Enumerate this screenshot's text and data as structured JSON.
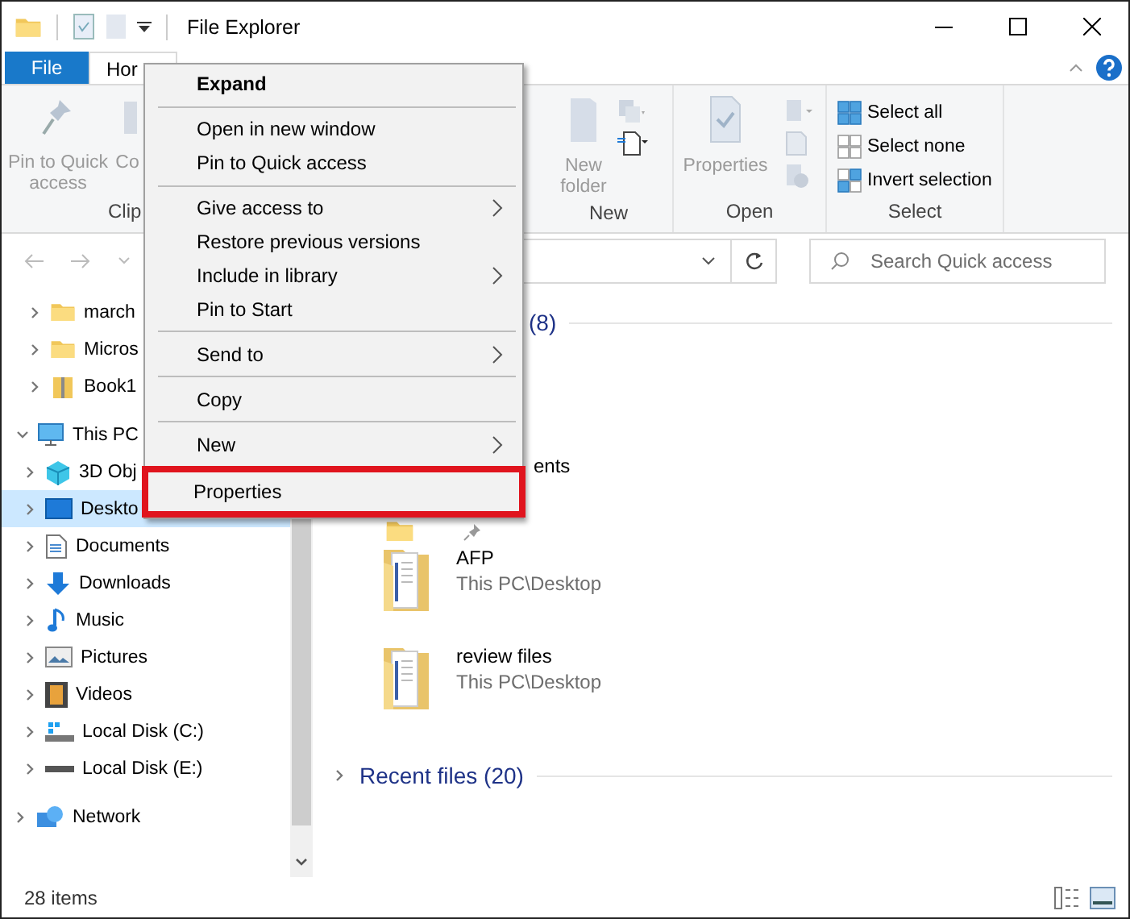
{
  "window": {
    "title": "File Explorer"
  },
  "ribbon": {
    "tabs": [
      {
        "label": "File",
        "kind": "file",
        "selected": false
      },
      {
        "label": "Hor",
        "kind": "tab",
        "selected": true
      }
    ],
    "clipboard": {
      "label": "Clip",
      "pin_button": {
        "label": "Pin to Quick access",
        "disabled": true
      },
      "copy_button": {
        "label": "Co",
        "disabled": true
      }
    },
    "new_group": {
      "label": "New",
      "new_folder_button": {
        "label": "New folder",
        "disabled": true
      }
    },
    "open_group": {
      "label": "Open",
      "properties_button": {
        "label": "Properties",
        "disabled": true
      }
    },
    "select_group": {
      "label": "Select",
      "items": [
        {
          "label": "Select all"
        },
        {
          "label": "Select none"
        },
        {
          "label": "Invert selection"
        }
      ]
    }
  },
  "search": {
    "placeholder": "Search Quick access"
  },
  "navigation": {
    "sections": [
      {
        "items": [
          {
            "label": "march",
            "expanded": false,
            "selected": false
          },
          {
            "label": "Micros",
            "expanded": false,
            "selected": false
          },
          {
            "label": "Book1",
            "expanded": false,
            "selected": false
          }
        ]
      },
      {
        "items": [
          {
            "label": "This PC",
            "expanded": true,
            "selected": false,
            "children": [
              {
                "label": "3D Obj",
                "expanded": false,
                "selected": false
              },
              {
                "label": "Deskto",
                "expanded": false,
                "selected": true
              },
              {
                "label": "Documents",
                "expanded": false,
                "selected": false
              },
              {
                "label": "Downloads",
                "expanded": false,
                "selected": false
              },
              {
                "label": "Music",
                "expanded": false,
                "selected": false
              },
              {
                "label": "Pictures",
                "expanded": false,
                "selected": false
              },
              {
                "label": "Videos",
                "expanded": false,
                "selected": false
              },
              {
                "label": "Local Disk (C:)",
                "expanded": false,
                "selected": false
              },
              {
                "label": "Local Disk (E:)",
                "expanded": false,
                "selected": false
              }
            ]
          }
        ]
      },
      {
        "items": [
          {
            "label": "Network",
            "expanded": false,
            "selected": false
          }
        ]
      }
    ]
  },
  "context_menu": {
    "items": [
      {
        "kind": "item",
        "label": "Expand",
        "default": true,
        "submenu": false,
        "highlighted": false
      },
      {
        "kind": "separator"
      },
      {
        "kind": "item",
        "label": "Open in new window",
        "default": false,
        "submenu": false,
        "highlighted": false
      },
      {
        "kind": "item",
        "label": "Pin to Quick access",
        "default": false,
        "submenu": false,
        "highlighted": false
      },
      {
        "kind": "separator"
      },
      {
        "kind": "item",
        "label": "Give access to",
        "default": false,
        "submenu": true,
        "highlighted": false
      },
      {
        "kind": "item",
        "label": "Restore previous versions",
        "default": false,
        "submenu": false,
        "highlighted": false
      },
      {
        "kind": "item",
        "label": "Include in library",
        "default": false,
        "submenu": true,
        "highlighted": false
      },
      {
        "kind": "item",
        "label": "Pin to Start",
        "default": false,
        "submenu": false,
        "highlighted": false
      },
      {
        "kind": "separator"
      },
      {
        "kind": "item",
        "label": "Send to",
        "default": false,
        "submenu": true,
        "highlighted": false
      },
      {
        "kind": "separator"
      },
      {
        "kind": "item",
        "label": "Copy",
        "default": false,
        "submenu": false,
        "highlighted": false
      },
      {
        "kind": "separator"
      },
      {
        "kind": "item",
        "label": "New",
        "default": false,
        "submenu": true,
        "highlighted": false
      },
      {
        "kind": "item",
        "label": "Properties",
        "default": false,
        "submenu": false,
        "highlighted": true
      }
    ]
  },
  "content": {
    "frequent_header": "(8)",
    "partial_tile": "ents",
    "tiles": [
      {
        "name": "AFP",
        "location": "This PC\\Desktop"
      },
      {
        "name": "review files",
        "location": "This PC\\Desktop"
      }
    ],
    "recent": {
      "label": "Recent files (20)",
      "expanded": false
    }
  },
  "status_bar": {
    "item_count": "28 items"
  }
}
